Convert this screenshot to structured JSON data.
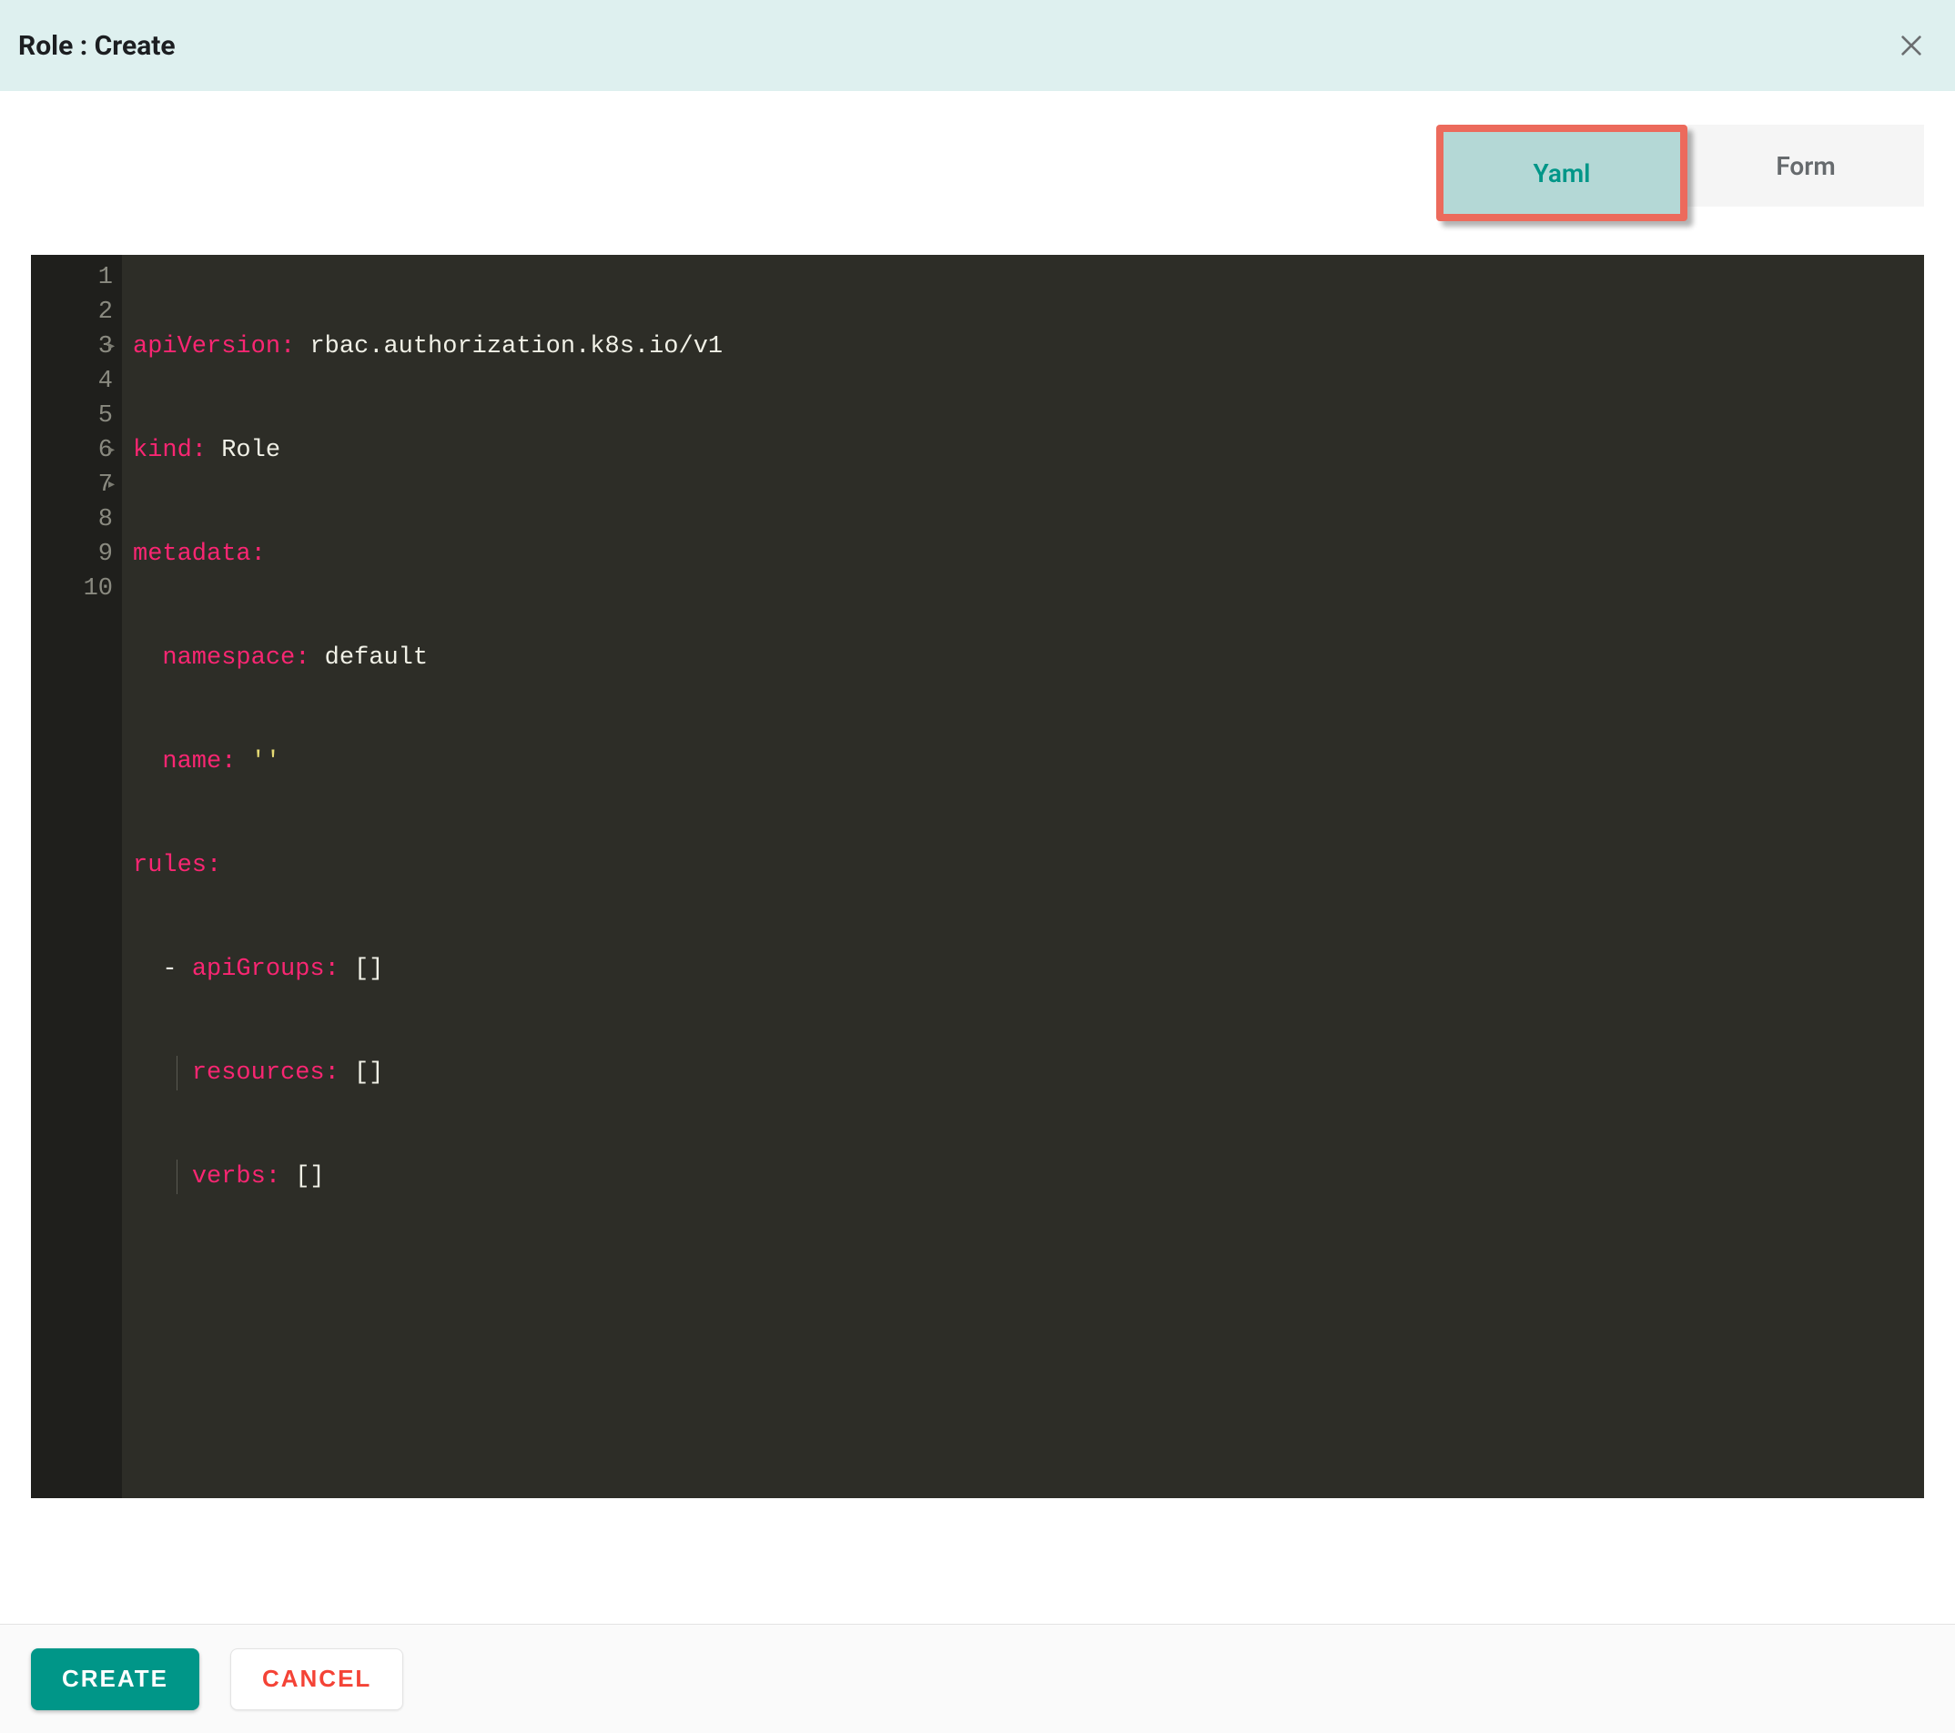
{
  "header": {
    "title": "Role : Create"
  },
  "tabs": {
    "yaml": "Yaml",
    "form": "Form"
  },
  "editor": {
    "lines": [
      "1",
      "2",
      "3",
      "4",
      "5",
      "6",
      "7",
      "8",
      "9",
      "10"
    ],
    "folds": {
      "l3": "▸",
      "l6": "▸",
      "l7": "▸"
    },
    "keys": {
      "apiVersion": "apiVersion:",
      "kind": "kind:",
      "metadata": "metadata:",
      "namespace": "namespace:",
      "name": "name:",
      "rules": "rules:",
      "apiGroups": "apiGroups:",
      "resources": "resources:",
      "verbs": "verbs:"
    },
    "values": {
      "apiVersion": "rbac.authorization.k8s.io/v1",
      "kind": "Role",
      "namespace": "default",
      "nameQuote": "''",
      "emptyArray": "[]"
    },
    "dash": "- "
  },
  "footer": {
    "create": "CREATE",
    "cancel": "CANCEL"
  }
}
